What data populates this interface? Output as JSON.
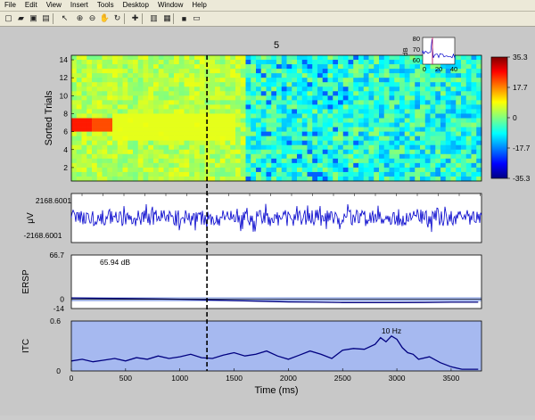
{
  "menu": [
    "File",
    "Edit",
    "View",
    "Insert",
    "Tools",
    "Desktop",
    "Window",
    "Help"
  ],
  "toolbar_icons": [
    "new-file-icon",
    "open-file-icon",
    "save-icon",
    "print-icon",
    "pointer-icon",
    "zoom-in-icon",
    "zoom-out-icon",
    "pan-icon",
    "rotate-icon",
    "data-cursor-icon",
    "colorbar-icon",
    "legend-icon",
    "hide-plot-tools-icon",
    "show-plot-tools-icon"
  ],
  "colors": {
    "bg": "#c8c8c8",
    "trace": "#0000cc",
    "itc_band": "#a6b9f0",
    "ersp_band": "#9fb2e8"
  },
  "figure": {
    "title": "5",
    "erpimage": {
      "ylabel": "Sorted Trials",
      "yticks": [
        "14",
        "12",
        "10",
        "8",
        "6",
        "4",
        "2"
      ],
      "ymin": 0.5,
      "ymax": 14.5
    },
    "colorbar": {
      "ticks": [
        "35.3",
        "17.7",
        "0",
        "-17.7",
        "-35.3"
      ]
    },
    "inset": {
      "ylabel": "dB",
      "yticks": [
        "80",
        "70",
        "60"
      ],
      "xticks": [
        "0",
        "20",
        "40"
      ]
    },
    "erp": {
      "ylabel": "μV",
      "yticks": [
        "2168.6001",
        "-2168.6001"
      ]
    },
    "ersp": {
      "ylabel": "ERSP",
      "yticks": [
        "66.7",
        "0",
        "-14"
      ],
      "annotation": "65.94 dB"
    },
    "itc": {
      "ylabel": "ITC",
      "yticks": [
        "0.6",
        "0"
      ],
      "annotation": "10 Hz"
    },
    "xaxis": {
      "label": "Time (ms)",
      "ticks": [
        "0",
        "500",
        "1000",
        "1500",
        "2000",
        "2500",
        "3000",
        "3500"
      ],
      "min": 0,
      "max": 3780
    },
    "event_marker_ms": 1250
  },
  "chart_data": [
    {
      "type": "heatmap",
      "title": "5",
      "ylabel": "Sorted Trials",
      "xlim": [
        0,
        3780
      ],
      "ylim": [
        0.5,
        14.5
      ],
      "clim": [
        -35.3,
        35.3
      ]
    },
    {
      "type": "line",
      "ylabel": "μV",
      "ylim": [
        -2168.6001,
        2168.6001
      ]
    },
    {
      "type": "line",
      "ylabel": "ERSP",
      "ylim": [
        -14,
        66.7
      ],
      "annotation": "65.94 dB",
      "x": [
        0,
        250,
        500,
        750,
        1000,
        1250,
        1500,
        1750,
        2000,
        2250,
        2500,
        2750,
        3000,
        3250,
        3500,
        3750
      ],
      "values": [
        2,
        1.5,
        1,
        0.5,
        0,
        -1,
        -2,
        -3,
        -4,
        -4.5,
        -5,
        -5,
        -5,
        -4.8,
        -4.5,
        -4.5
      ]
    },
    {
      "type": "line",
      "ylabel": "ITC",
      "ylim": [
        0,
        0.6
      ],
      "annotation": "10 Hz",
      "x": [
        0,
        100,
        200,
        300,
        400,
        500,
        600,
        700,
        800,
        900,
        1000,
        1100,
        1200,
        1300,
        1400,
        1500,
        1600,
        1700,
        1800,
        1900,
        2000,
        2100,
        2200,
        2300,
        2400,
        2500,
        2600,
        2700,
        2800,
        2850,
        2900,
        2950,
        3000,
        3050,
        3100,
        3150,
        3200,
        3300,
        3400,
        3500,
        3600,
        3750
      ],
      "values": [
        0.12,
        0.14,
        0.11,
        0.13,
        0.15,
        0.12,
        0.16,
        0.14,
        0.18,
        0.15,
        0.17,
        0.2,
        0.16,
        0.15,
        0.19,
        0.22,
        0.18,
        0.2,
        0.24,
        0.18,
        0.14,
        0.19,
        0.24,
        0.2,
        0.15,
        0.25,
        0.27,
        0.26,
        0.32,
        0.4,
        0.35,
        0.42,
        0.38,
        0.28,
        0.22,
        0.2,
        0.14,
        0.17,
        0.1,
        0.05,
        0.02,
        0.02
      ]
    }
  ]
}
